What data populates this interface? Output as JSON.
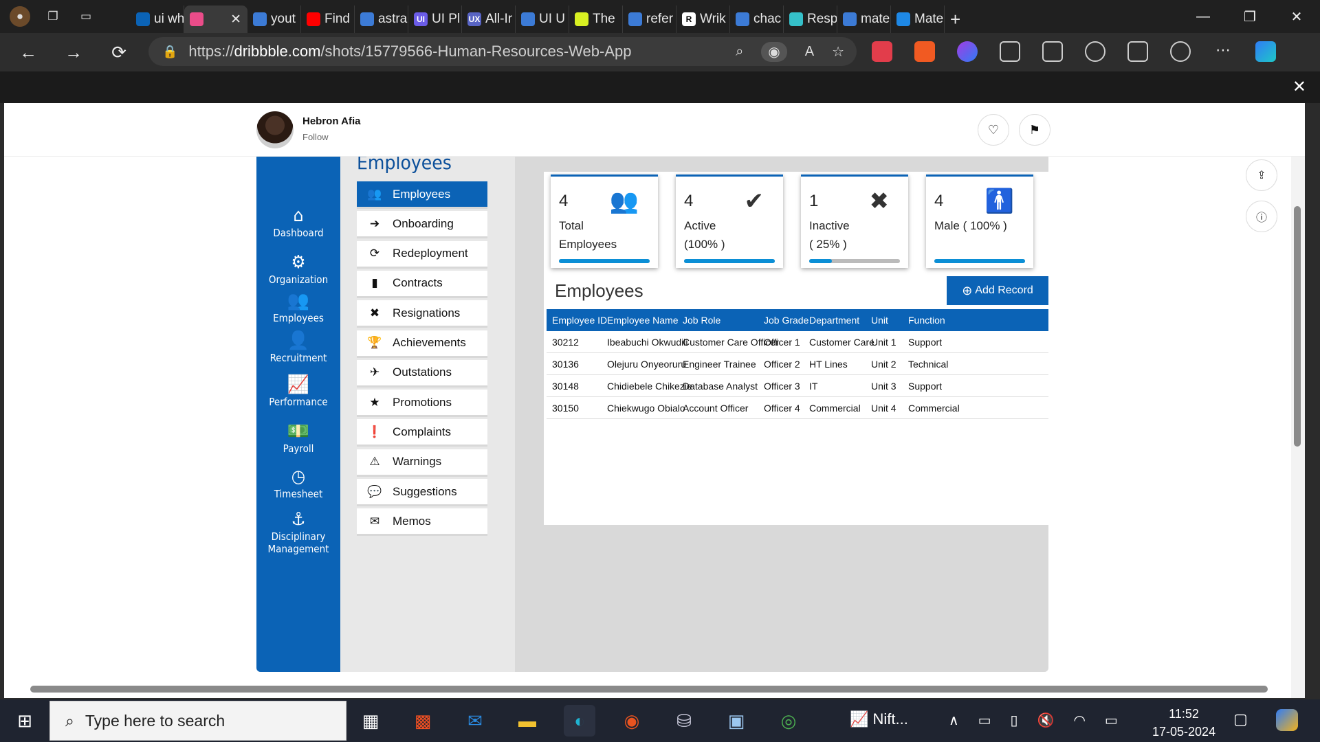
{
  "browser": {
    "tabs": [
      {
        "label": "ui wh",
        "color": "#0b63b6"
      },
      {
        "label": "",
        "color": "#ea4c89",
        "active": true
      },
      {
        "label": "yout",
        "color": "#3c7bd6"
      },
      {
        "label": "Find",
        "color": "#ff0000"
      },
      {
        "label": "astra",
        "color": "#3c7bd6"
      },
      {
        "label": "UI Pl",
        "color": "#6b5ce7",
        "badge": "UI"
      },
      {
        "label": "All-Ir",
        "color": "#5864c4",
        "badge": "UX"
      },
      {
        "label": "UI U",
        "color": "#3c7bd6"
      },
      {
        "label": "The",
        "color": "#d8f022"
      },
      {
        "label": "refer",
        "color": "#3c7bd6"
      },
      {
        "label": "Wrik",
        "color": "#ffffff",
        "badge": "R"
      },
      {
        "label": "chac",
        "color": "#3c7bd6"
      },
      {
        "label": "Resp",
        "color": "#35c0c9"
      },
      {
        "label": "mate",
        "color": "#3c7bd6"
      },
      {
        "label": "Mate",
        "color": "#1e88e5"
      }
    ],
    "url_prefix": "https://",
    "url_domain": "dribbble.com",
    "url_path": "/shots/15779566-Human-Resources-Web-App"
  },
  "modal": {
    "author": "Hebron Afia",
    "follow": "Follow"
  },
  "app": {
    "nav": [
      {
        "label": "Dashboard",
        "icon": "⌂"
      },
      {
        "label": "Organization",
        "icon": "⚙"
      },
      {
        "label": "Employees",
        "icon": "👥"
      },
      {
        "label": "Recruitment",
        "icon": "👤"
      },
      {
        "label": "Performance",
        "icon": "📈"
      },
      {
        "label": "Payroll",
        "icon": "💵"
      },
      {
        "label": "Timesheet",
        "icon": "◷"
      },
      {
        "label": "Disciplinary Management",
        "icon": "⚓"
      }
    ],
    "submenu_title": "Employees",
    "submenu": [
      {
        "label": "Employees",
        "icon": "👥",
        "active": true
      },
      {
        "label": "Onboarding",
        "icon": "➔"
      },
      {
        "label": "Redeployment",
        "icon": "⟳"
      },
      {
        "label": "Contracts",
        "icon": "▮"
      },
      {
        "label": "Resignations",
        "icon": "✖"
      },
      {
        "label": "Achievements",
        "icon": "🏆"
      },
      {
        "label": "Outstations",
        "icon": "✈"
      },
      {
        "label": "Promotions",
        "icon": "★"
      },
      {
        "label": "Complaints",
        "icon": "❗"
      },
      {
        "label": "Warnings",
        "icon": "⚠"
      },
      {
        "label": "Suggestions",
        "icon": "💬"
      },
      {
        "label": "Memos",
        "icon": "✉"
      }
    ],
    "cards": [
      {
        "value": "4",
        "label_lines": [
          "Total",
          "Employees"
        ],
        "icon": "👥",
        "progress": 1.0
      },
      {
        "value": "4",
        "label_lines": [
          "Active",
          "(100% )"
        ],
        "icon": "✔",
        "progress": 1.0
      },
      {
        "value": "1",
        "label_lines": [
          "Inactive",
          "( 25% )"
        ],
        "icon": "✖",
        "progress": 0.25
      },
      {
        "value": "4",
        "label_lines": [
          "Male ( 100% )",
          ""
        ],
        "icon": "🚹",
        "progress": 1.0
      }
    ],
    "section_title": "Employees",
    "add_record": "Add Record",
    "table": {
      "headers": [
        "Employee ID",
        "Employee Name",
        "Job Role",
        "Job Grade",
        "Department",
        "Unit",
        "Function"
      ],
      "rows": [
        [
          "30212",
          "Ibeabuchi Okwudili",
          "Customer Care Officer",
          "Officer 1",
          "Customer Care",
          "Unit 1",
          "Support"
        ],
        [
          "30136",
          "Olejuru Onyeoruru",
          "Engineer Trainee",
          "Officer 2",
          "HT Lines",
          "Unit 2",
          "Technical"
        ],
        [
          "30148",
          "Chidiebele Chikezie",
          "Database Analyst",
          "Officer 3",
          "IT",
          "Unit 3",
          "Support"
        ],
        [
          "30150",
          "Chiekwugo Obialo",
          "Account Officer",
          "Officer 4",
          "Commercial",
          "Unit 4",
          "Commercial"
        ]
      ]
    }
  },
  "taskbar": {
    "search_placeholder": "Type here to search",
    "nifty": "Nift...",
    "time": "11:52",
    "date": "17-05-2024"
  },
  "colors": {
    "brand_blue": "#0b63b6",
    "progress": "#0b8fd6"
  }
}
